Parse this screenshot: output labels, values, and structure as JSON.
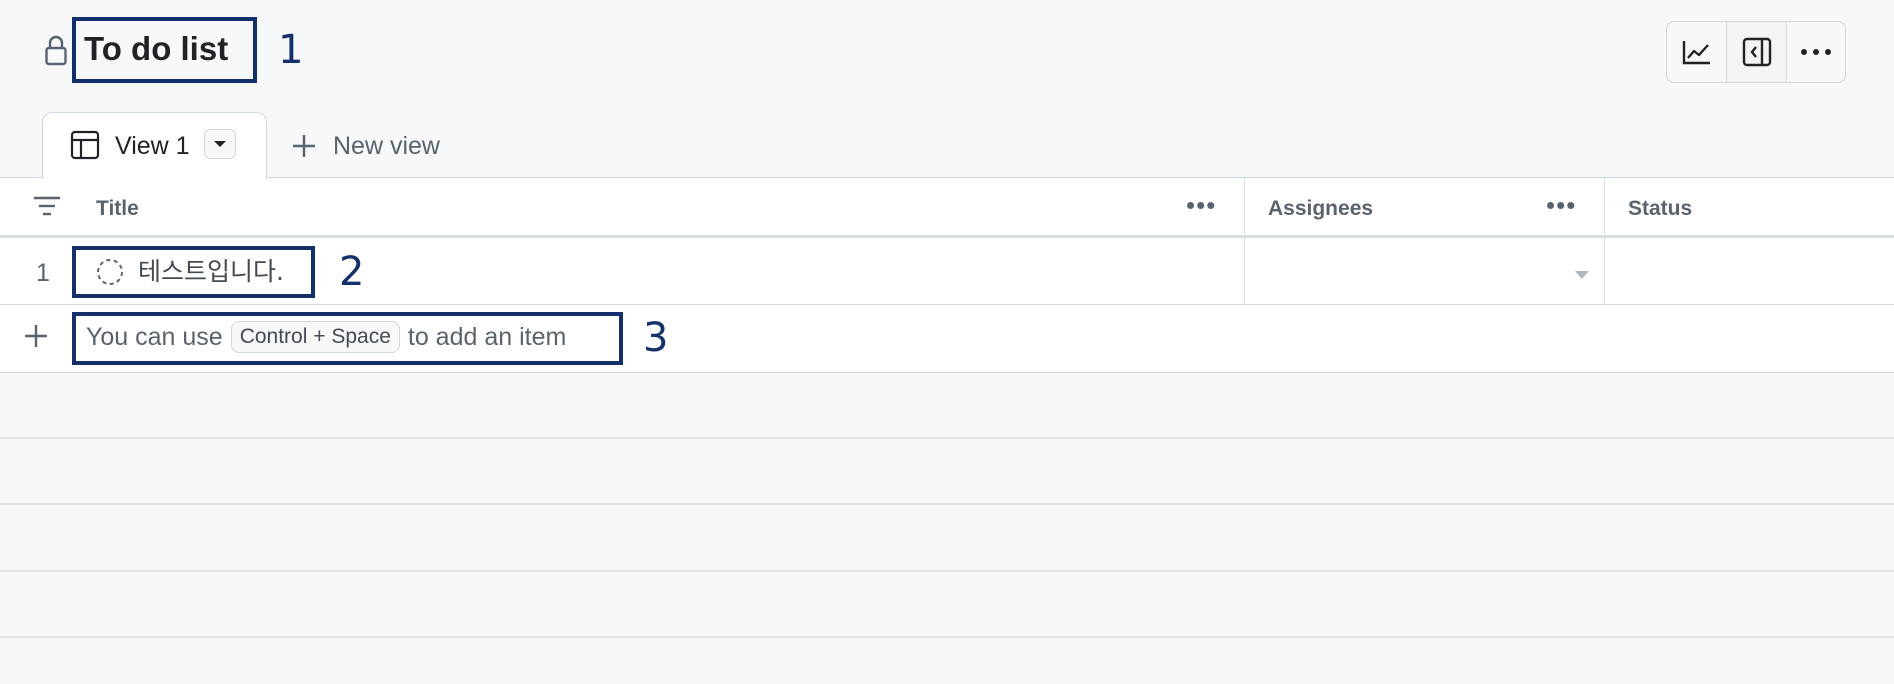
{
  "header": {
    "lock_icon": "lock-icon",
    "title": "To do list",
    "toolbar": {
      "items": [
        {
          "icon": "chart-line-icon",
          "name": "Insights"
        },
        {
          "icon": "sidebar-collapse-icon",
          "name": "Side panel"
        },
        {
          "icon": "more-horizontal-icon",
          "name": "More options"
        }
      ]
    }
  },
  "tabs": {
    "active": {
      "icon": "table-icon",
      "label": "View 1",
      "dropdown_icon": "caret-down-icon"
    },
    "new_view": {
      "icon": "plus-icon",
      "label": "New view"
    }
  },
  "table": {
    "filter_icon": "filter-icon",
    "columns": [
      {
        "label": "Title",
        "menu": "•••"
      },
      {
        "label": "Assignees",
        "menu": "•••"
      },
      {
        "label": "Status"
      }
    ],
    "rows": [
      {
        "number": "1",
        "status_icon": "draft-circle-icon",
        "title": "테스트입니다.",
        "assignees": "",
        "status": ""
      }
    ],
    "add_row": {
      "icon": "plus-icon",
      "prefix": "You can use",
      "shortcut": "Control + Space",
      "suffix": "to add an item"
    }
  },
  "annotations": {
    "callout_1": "1",
    "callout_2": "2",
    "callout_3": "3",
    "box_color": "#14306b"
  }
}
